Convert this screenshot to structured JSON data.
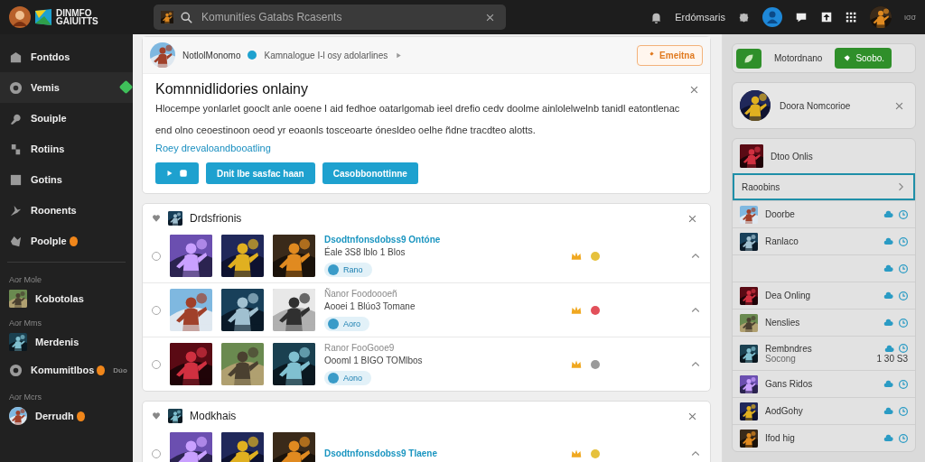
{
  "topbar": {
    "logo": [
      "DINMFO",
      "GAIUITTS"
    ],
    "search": {
      "placeholder": "Komunitíes Gatabs Rcasents"
    },
    "notifications": "Erdómsaris",
    "user_tag": "ισσ"
  },
  "sidebar": {
    "groups": [
      {
        "items": [
          {
            "label": "Fontdos",
            "kind": "icon",
            "badge": false,
            "selected": false
          },
          {
            "label": "Vemis",
            "kind": "icon",
            "badge": false,
            "selected": true
          },
          {
            "label": "Souiple",
            "kind": "icon",
            "badge": false,
            "selected": false
          },
          {
            "label": "Rotiins",
            "kind": "icon",
            "badge": false,
            "selected": false
          },
          {
            "label": "Gotins",
            "kind": "icon",
            "badge": false,
            "selected": false
          },
          {
            "label": "Roonents",
            "kind": "icon",
            "badge": false,
            "selected": false
          },
          {
            "label": "Poolple",
            "kind": "icon",
            "badge": true,
            "selected": false
          }
        ]
      },
      {
        "heading": "Aor Mole",
        "items": [
          {
            "label": "Kobotolas",
            "kind": "picture",
            "badge": false,
            "selected": false
          }
        ]
      },
      {
        "heading": "Aor Mms",
        "items": [
          {
            "label": "Merdenis",
            "kind": "picture",
            "badge": false,
            "selected": false
          },
          {
            "label": "Komumitlbos",
            "kind": "icon",
            "badge": true,
            "extra": "Dúo",
            "selected": false
          }
        ]
      },
      {
        "heading": "Aor Mcrs",
        "items": [
          {
            "label": "Derrudh",
            "kind": "avatar",
            "badge": true,
            "selected": false
          }
        ]
      }
    ]
  },
  "intro_card": {
    "user": "NotlolMonomo",
    "tag": "Kamnalogue I-l osy adolarlines",
    "action": "Emeitna",
    "title": "Komnnidlidories onlainy",
    "text": "Hlocempe yonlarlet gooclt anle ooene I aid fedhoe oatarlgomab ieel drefio cedv doolme ainlolelwelnb tanidl eatontlenac end olno ceoestinoon oeod yr eoaonls tosceoarte ónesldeo oelhe ñdne tracdteo alotts.",
    "link": "Roey drevaloandbooatling",
    "buttons": [
      "Dnit lbe sasfac haan",
      "Casobbonottinne"
    ]
  },
  "groups": [
    {
      "title": "Drdsfrionis",
      "rows": [
        {
          "title": "Dsodtnfonsdobss9 Ontóne",
          "subtitle": "Éale 3S8 lblo 1 Blos",
          "pill": "Rano",
          "highlight": true,
          "selected": false,
          "color": "#e6c13c"
        },
        {
          "title": "Ñanor Foodoooeñ",
          "subtitle": "Aooei 1 Blúo3 Tomane",
          "pill": "Aoro",
          "highlight": false,
          "selected": false,
          "color": "#e2505a"
        },
        {
          "title": "Ranor FooGooe9",
          "subtitle": "Oooml 1 BIGO TOMlbos",
          "pill": "Aono",
          "highlight": false,
          "selected": false,
          "color": "#9a9a9a"
        }
      ]
    },
    {
      "title": "Modkhais",
      "rows": [
        {
          "title": "Dsodtnfonsdobss9 Tlaene",
          "highlight": true,
          "selected": false,
          "color": "#e6c13c"
        }
      ]
    }
  ],
  "right": {
    "tabs": [
      {
        "label": "Motordnano",
        "selected": false
      },
      {
        "label": "Soobo.",
        "selected": true
      }
    ],
    "profile": {
      "name": "Doora Nomcorioe"
    },
    "friends_header": "Dtoo Onlis",
    "friends": [
      {
        "name": "Raoobins",
        "kind": "link",
        "selected": true
      },
      {
        "name": "Doorbe",
        "kind": "friend",
        "selected": false
      },
      {
        "name": "Ranlaco",
        "kind": "friend",
        "selected": false
      },
      {
        "kind": "icons",
        "selected": false
      },
      {
        "name": "Dea Onling",
        "kind": "friend",
        "selected": false
      },
      {
        "name": "Nenslies",
        "kind": "friend",
        "selected": false
      },
      {
        "name": "Rembndres",
        "sub": "Socong",
        "time": "1 30  S3",
        "kind": "friend",
        "selected": false
      },
      {
        "name": "Gans Ridos",
        "kind": "friend",
        "selected": false
      },
      {
        "name": "AodGohy",
        "kind": "friend",
        "selected": false
      },
      {
        "name": "Ifod hig",
        "kind": "friend",
        "selected": false
      }
    ]
  }
}
